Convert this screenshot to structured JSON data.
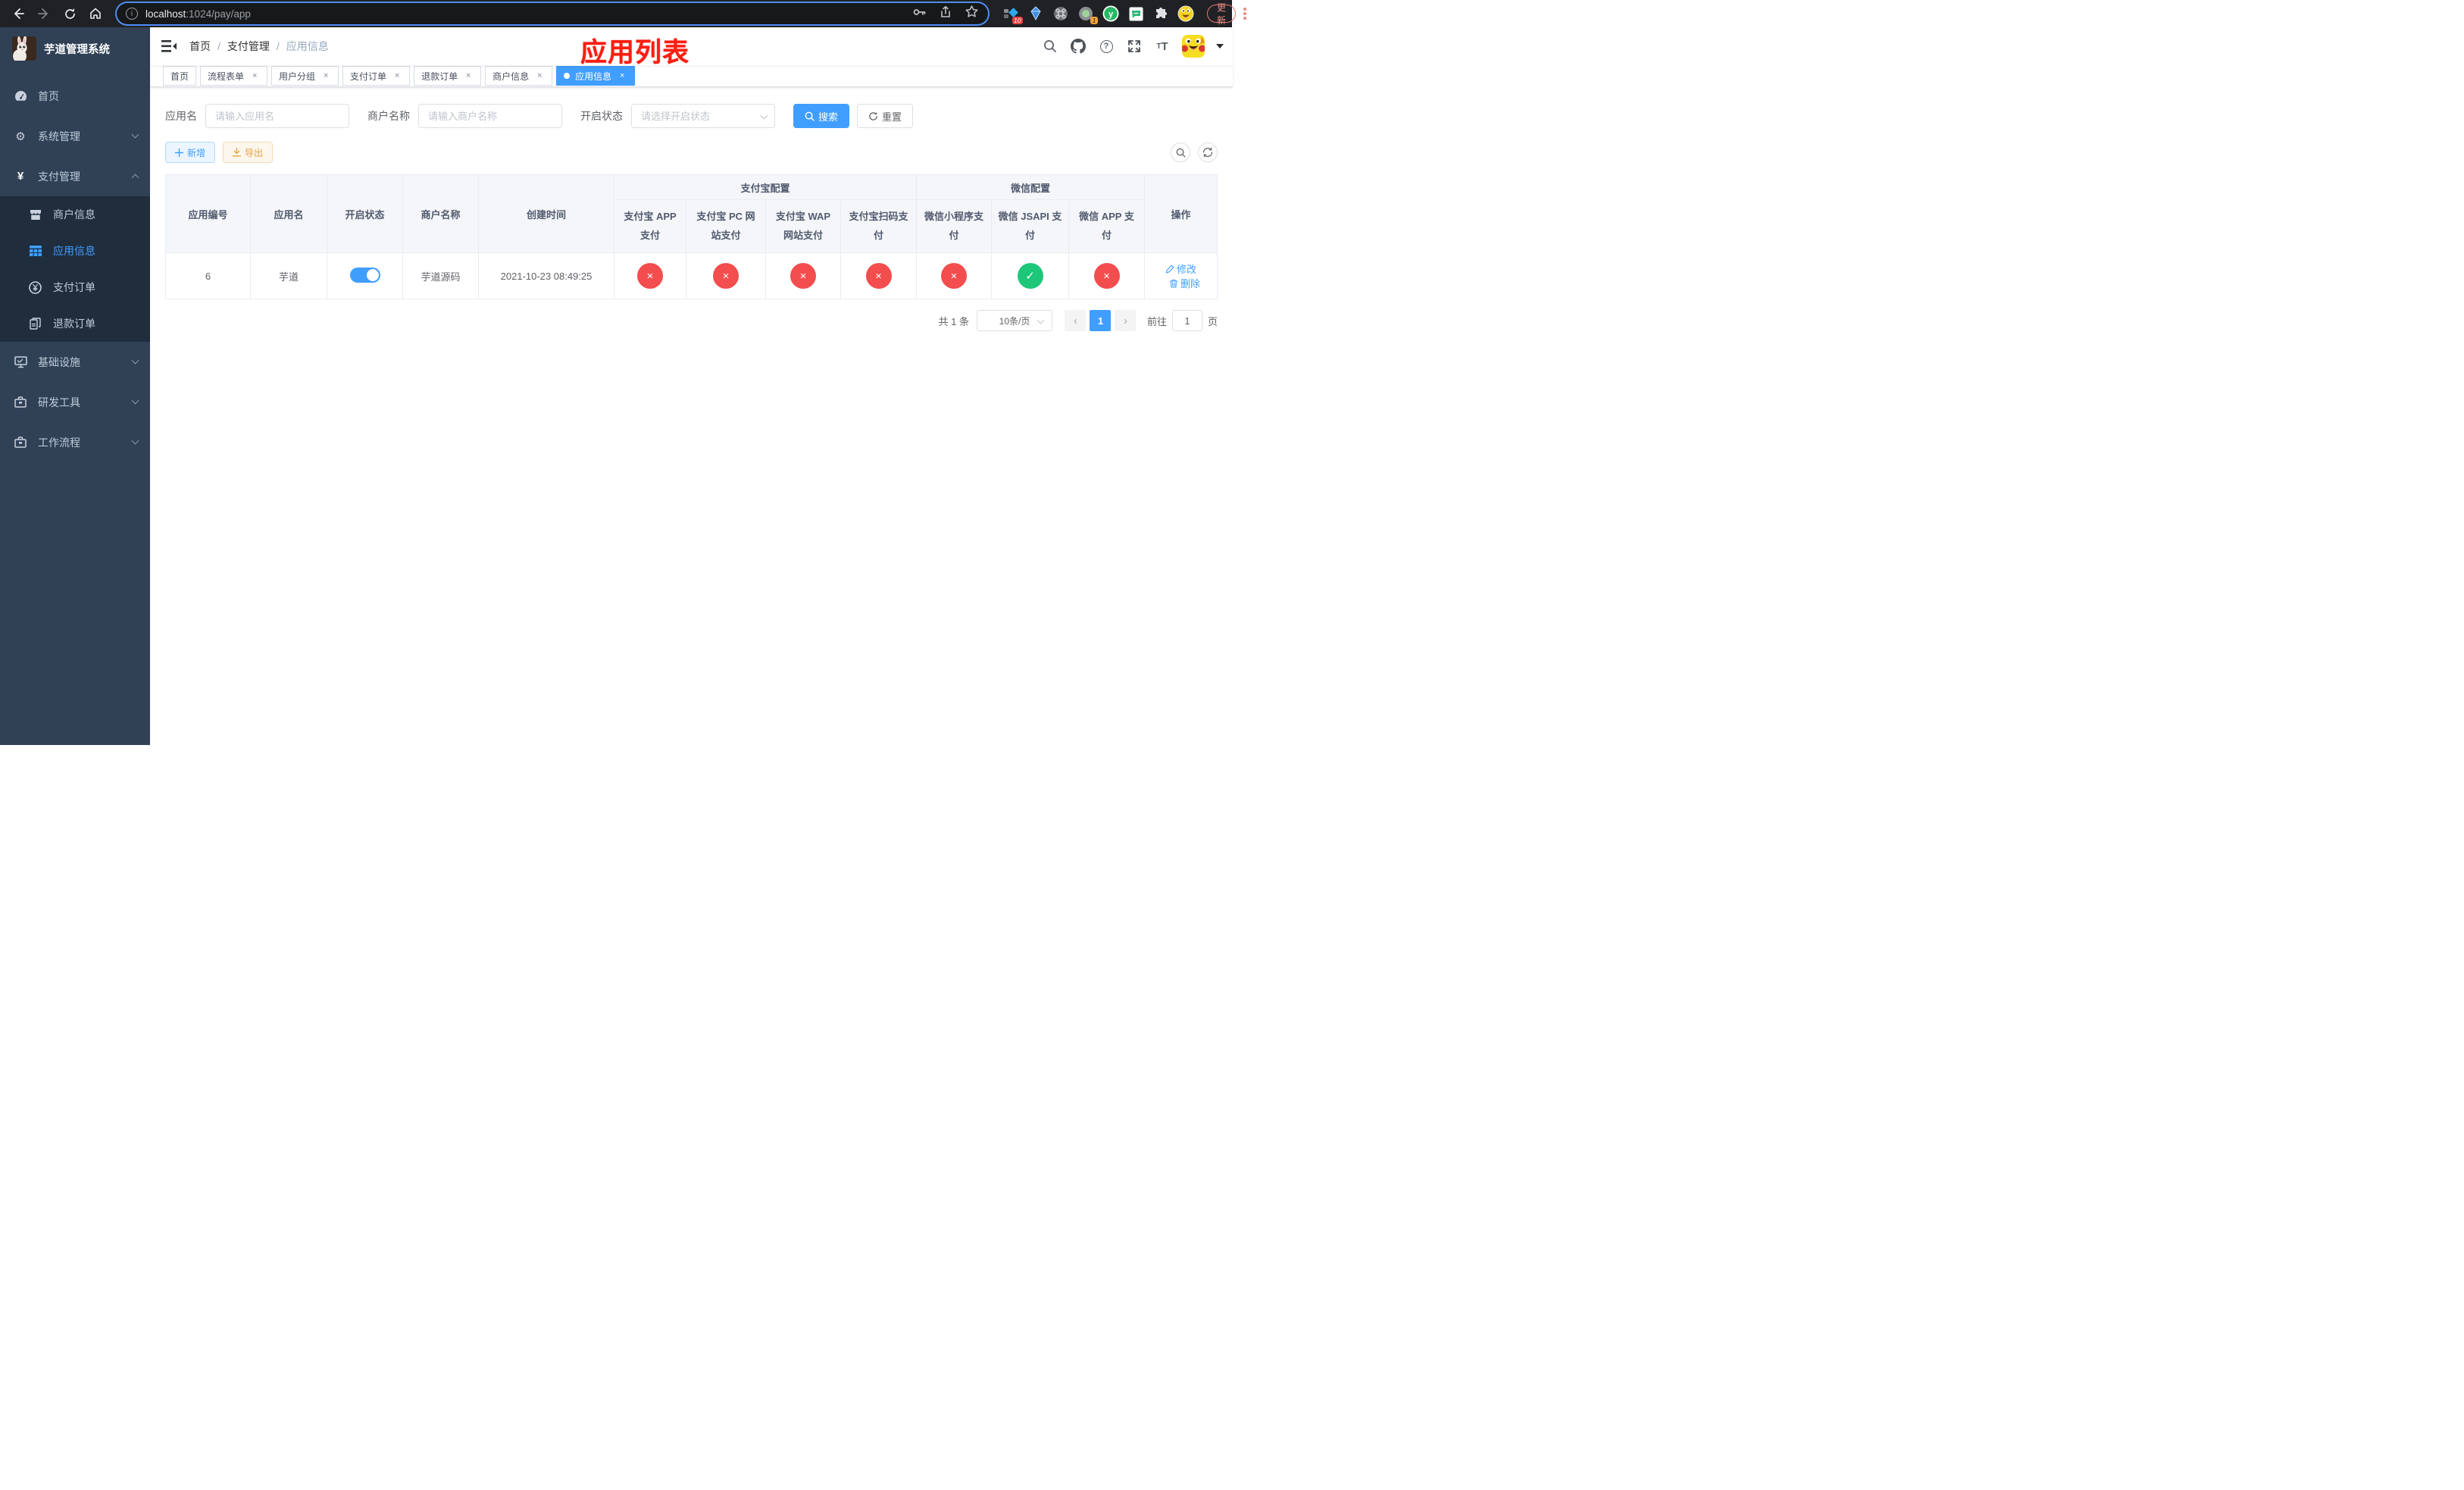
{
  "colors": {
    "accent": "#409eff",
    "danger": "#f34d4d",
    "success": "#1dc779",
    "warning": "#e6a23c",
    "annotation_red": "#fb1e12",
    "sidebar_bg": "#304156",
    "submenu_bg": "#1f2d3d"
  },
  "glyphs": {
    "cross": "×",
    "check": "✓",
    "close": "×",
    "prev": "‹",
    "next": "›",
    "gear": "⚙",
    "yen": "¥",
    "question": "?",
    "info": "i",
    "font_big": "T",
    "font_small": "T"
  },
  "browser": {
    "url_host": "localhost",
    "url_rest": ":1024/pay/app",
    "ext_badge_a": "10",
    "ext_badge_b": "1",
    "ext_y_letter": "y",
    "update_button": "更新"
  },
  "sidebar": {
    "title": "芋道管理系统",
    "home": "首页",
    "system": "系统管理",
    "payment": "支付管理",
    "sub_merchant": "商户信息",
    "sub_app": "应用信息",
    "sub_pay_order": "支付订单",
    "sub_refund_order": "退款订单",
    "infra": "基础设施",
    "dev_tools": "研发工具",
    "workflow": "工作流程"
  },
  "navbar": {
    "breadcrumb_home": "首页",
    "breadcrumb_sep": "/",
    "breadcrumb_section": "支付管理",
    "breadcrumb_current": "应用信息",
    "annotation": "应用列表"
  },
  "tags": {
    "items": [
      {
        "label": "首页",
        "cls": "tag"
      },
      {
        "label": "流程表单",
        "cls": "tag closable"
      },
      {
        "label": "用户分组",
        "cls": "tag closable"
      },
      {
        "label": "支付订单",
        "cls": "tag closable"
      },
      {
        "label": "退款订单",
        "cls": "tag closable"
      },
      {
        "label": "商户信息",
        "cls": "tag closable"
      },
      {
        "label": "应用信息",
        "cls": "tag closable active"
      }
    ]
  },
  "search": {
    "app_name_label": "应用名",
    "app_name_placeholder": "请输入应用名",
    "merchant_label": "商户名称",
    "merchant_placeholder": "请输入商户名称",
    "status_label": "开启状态",
    "status_placeholder": "请选择开启状态",
    "search_button": "搜索",
    "reset_button": "重置"
  },
  "toolbar": {
    "add_button": "新增",
    "export_button": "导出"
  },
  "table": {
    "headers": {
      "app_id": "应用编号",
      "app_name": "应用名",
      "status": "开启状态",
      "merchant": "商户名称",
      "created": "创建时间",
      "alipay_group": "支付宝配置",
      "wechat_group": "微信配置",
      "alipay_app": "支付宝 APP 支付",
      "alipay_pc": "支付宝 PC 网站支付",
      "alipay_wap": "支付宝 WAP 网站支付",
      "alipay_qr": "支付宝扫码支付",
      "wx_mini": "微信小程序支付",
      "wx_jsapi": "微信 JSAPI 支付",
      "wx_app": "微信 APP 支付",
      "actions": "操作"
    },
    "row": {
      "app_id": "6",
      "app_name": "芋道",
      "switch_cls": "switch on",
      "merchant": "芋道源码",
      "created": "2021-10-23 08:49:25",
      "channels": [
        {
          "name": "alipay-app-pay",
          "glyph": "×",
          "cls": "status-circle cross"
        },
        {
          "name": "alipay-pc-pay",
          "glyph": "×",
          "cls": "status-circle cross"
        },
        {
          "name": "alipay-wap-pay",
          "glyph": "×",
          "cls": "status-circle cross"
        },
        {
          "name": "alipay-qr-pay",
          "glyph": "×",
          "cls": "status-circle cross"
        },
        {
          "name": "wx-mini-pay",
          "glyph": "×",
          "cls": "status-circle cross"
        },
        {
          "name": "wx-jsapi-pay",
          "glyph": "✓",
          "cls": "status-circle check"
        },
        {
          "name": "wx-app-pay",
          "glyph": "×",
          "cls": "status-circle cross"
        }
      ],
      "edit": "修改",
      "delete": "删除"
    }
  },
  "pagination": {
    "total": "共 1 条",
    "page_size": "10条/页",
    "prev": "‹",
    "page": "1",
    "next": "›",
    "goto_label": "前往",
    "goto_value": "1",
    "page_unit": "页"
  }
}
